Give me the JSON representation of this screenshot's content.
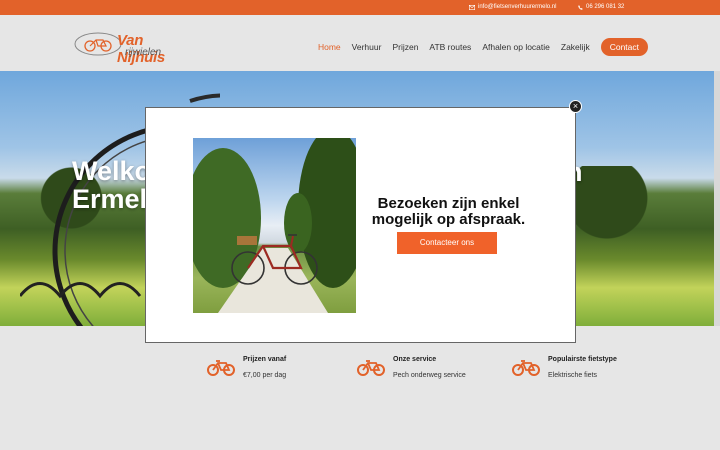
{
  "topbar": {
    "email": "info@fietsenverhuurermelo.nl",
    "email_icon": "envelope-icon",
    "phone": "06 296 081 32",
    "phone_icon": "phone-icon"
  },
  "header": {
    "logo_brand": "Van Nijhuis",
    "logo_sub": "rijwielen",
    "nav": [
      {
        "label": "Home",
        "active": true
      },
      {
        "label": "Verhuur"
      },
      {
        "label": "Prijzen"
      },
      {
        "label": "ATB routes"
      },
      {
        "label": "Afhalen op locatie"
      },
      {
        "label": "Zakelijk"
      },
      {
        "label": "Contact",
        "button": true
      }
    ]
  },
  "hero": {
    "title_line1": "Welko",
    "title_line2": "Ermel",
    "title_right": "n"
  },
  "features": [
    {
      "icon": "bicycle-icon",
      "title": "Prijzen vanaf",
      "value": "€7,00 per dag"
    },
    {
      "icon": "bicycle-icon",
      "title": "Onze service",
      "value": "Pech onderweg service"
    },
    {
      "icon": "bicycle-icon",
      "title": "Populairste fietstype",
      "value": "Elektrische fiets"
    }
  ],
  "modal": {
    "message": "Bezoeken zijn enkel mogelijk op afspraak.",
    "cta_label": "Contacteer ons",
    "close_label": "×"
  },
  "colors": {
    "accent": "#e2622a",
    "background": "#e6e6e6"
  }
}
